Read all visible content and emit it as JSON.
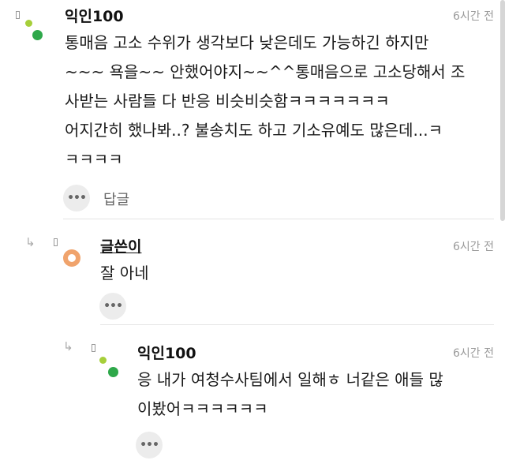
{
  "comments": [
    {
      "author": "익인100",
      "time": "6시간 전",
      "body": "통매음 고소 수위가 생각보다 낮은데도 가능하긴 하지만\n~~~ 욕을~~ 안했어야지~~^^통매음으로 고소당해서 조\n사받는 사람들 다 반응 비슷비슷함ㅋㅋㅋㅋㅋㅋㅋ\n어지간히 했나봐..? 불송치도 하고 기소유예도 많은데...ㅋ\nㅋㅋㅋㅋ",
      "more": "•••",
      "reply_label": "답글"
    },
    {
      "author": "글쓴이",
      "time": "6시간 전",
      "body": "잘 아네",
      "more": "•••"
    },
    {
      "author": "익인100",
      "time": "6시간 전",
      "body": "응 내가 여청수사팀에서 일해ㅎ 너같은 애들 많\n이봤어ㅋㅋㅋㅋㅋㅋ",
      "more": "•••"
    }
  ],
  "icons": {
    "reply_arrow": "reply-arrow-icon",
    "avatar_green": "#2ea84a",
    "avatar_lime": "#a6cf3a",
    "avatar_orange": "#f0a36c"
  }
}
